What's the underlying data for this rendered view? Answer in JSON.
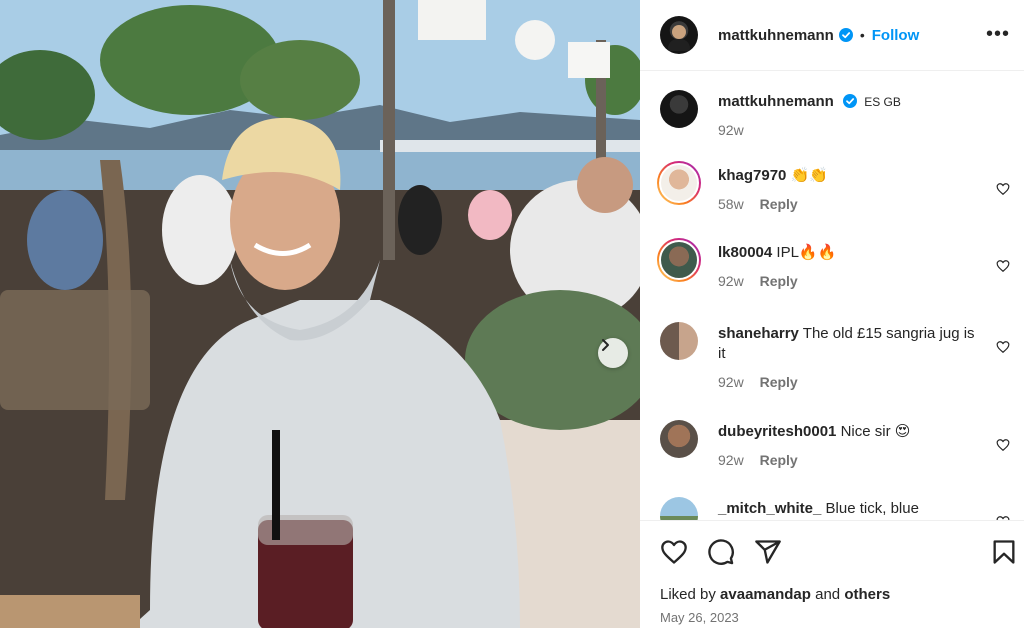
{
  "post": {
    "author": "mattkuhnemann",
    "follow_label": "Follow",
    "dot": "•",
    "more_label": "•••",
    "caption": {
      "user": "mattkuhnemann",
      "text": "ES GB",
      "time": "92w"
    }
  },
  "comments": [
    {
      "user": "khag7970",
      "text": "👏👏",
      "time": "58w",
      "reply": "Reply"
    },
    {
      "user": "lk80004",
      "text": "IPL🔥🔥",
      "time": "92w",
      "reply": "Reply"
    },
    {
      "user": "shaneharry",
      "text": "The old £15 sangria jug is it",
      "time": "92w",
      "reply": "Reply"
    },
    {
      "user": "dubeyritesh0001",
      "text": "Nice sir 😍",
      "time": "92w",
      "reply": "Reply"
    },
    {
      "user": "_mitch_white_",
      "text": "Blue tick, blue",
      "time": "",
      "reply": ""
    }
  ],
  "likes": {
    "prefix": "Liked by",
    "user": "avaamandap",
    "and": "and",
    "others": "others"
  },
  "date": "May 26, 2023",
  "colors": {
    "accent": "#0095f6",
    "verified": "#0095f6",
    "muted": "#737373"
  },
  "icons": [
    "verified-badge-icon",
    "more-options-icon",
    "heart-icon",
    "comment-icon",
    "share-icon",
    "bookmark-icon",
    "chevron-right-icon"
  ]
}
